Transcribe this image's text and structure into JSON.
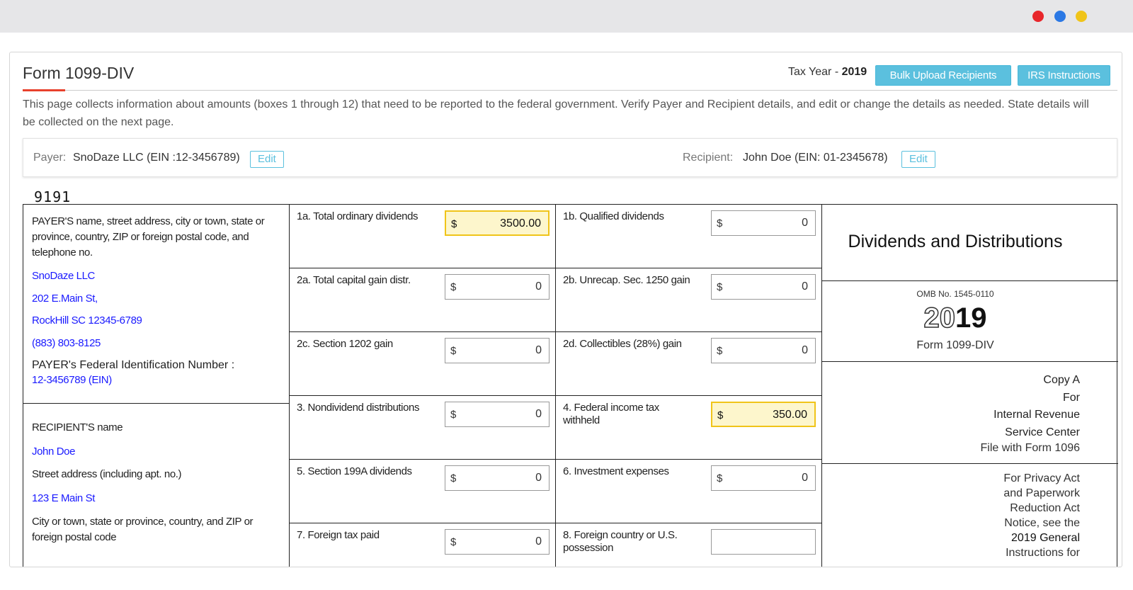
{
  "window": {
    "dots": {
      "red": "#e8262b",
      "blue": "#2b78e4",
      "yellow": "#f0c419"
    }
  },
  "header": {
    "title": "Form 1099-DIV",
    "tax_year_label": "Tax Year - ",
    "tax_year_value": "2019",
    "bulk_upload_label": "Bulk Upload Recipients",
    "irs_instructions_label": "IRS Instructions",
    "accent_color": "#5bc0de"
  },
  "description": "This page collects information about amounts (boxes 1 through 12) that need to be reported to the federal government. Verify Payer and Recipient details, and edit or change the details as needed. State details will be collected on the next page.",
  "party": {
    "payer_label": "Payer:",
    "payer_value": "SnoDaze LLC (EIN :12-3456789)",
    "recipient_label": "Recipient:",
    "recipient_value": "John Doe (EIN: 01-2345678)",
    "edit_label": "Edit"
  },
  "form": {
    "number": "9191",
    "payer_heading": "PAYER'S name, street address, city or town, state or province, country, ZIP or foreign postal code, and telephone no.",
    "payer_name": "SnoDaze LLC",
    "payer_street": "202 E.Main St,",
    "payer_city": "RockHill SC 12345-6789",
    "payer_phone": "(883) 803-8125",
    "payer_fin_label": "PAYER's Federal Identification Number :",
    "payer_fin_value": "12-3456789 (EIN)",
    "recipient_heading": "RECIPIENT'S name",
    "recipient_name": "John Doe",
    "street_heading": "Street address (including apt. no.)",
    "recipient_street": "123 E Main St",
    "city_heading": "City or town, state or province, country, and ZIP or foreign postal code",
    "currency": "$",
    "boxes": [
      {
        "label": "1a. Total ordinary dividends",
        "value": "3500.00",
        "highlight": true
      },
      {
        "label": "1b. Qualified dividends",
        "value": "0",
        "highlight": false
      },
      {
        "label": "2a. Total capital gain distr.",
        "value": "0",
        "highlight": false
      },
      {
        "label": "2b. Unrecap. Sec. 1250 gain",
        "value": "0",
        "highlight": false
      },
      {
        "label": "2c. Section 1202 gain",
        "value": "0",
        "highlight": false
      },
      {
        "label": "2d. Collectibles (28%) gain",
        "value": "0",
        "highlight": false
      },
      {
        "label": "3. Nondividend distributions",
        "value": "0",
        "highlight": false
      },
      {
        "label": "4. Federal income tax withheld",
        "value": "350.00",
        "highlight": true
      },
      {
        "label": "5. Section 199A dividends",
        "value": "0",
        "highlight": false
      },
      {
        "label": "6. Investment expenses",
        "value": "0",
        "highlight": false
      },
      {
        "label": "7. Foreign tax paid",
        "value": "0",
        "highlight": false
      },
      {
        "label": "8. Foreign country or U.S. possession",
        "value": "",
        "highlight": false
      }
    ],
    "side_title": "Dividends and Distributions",
    "omb": "OMB No. 1545-0110",
    "year_outline": "20",
    "year_bold": "19",
    "side_form_name": "Form 1099-DIV",
    "copy_lines": [
      "Copy A",
      "For",
      "Internal Revenue",
      "Service Center",
      "File with Form 1096"
    ],
    "privacy_lines": [
      "For Privacy Act",
      "and Paperwork",
      "Reduction Act",
      "Notice, see the",
      "2019 General",
      "Instructions for"
    ]
  }
}
